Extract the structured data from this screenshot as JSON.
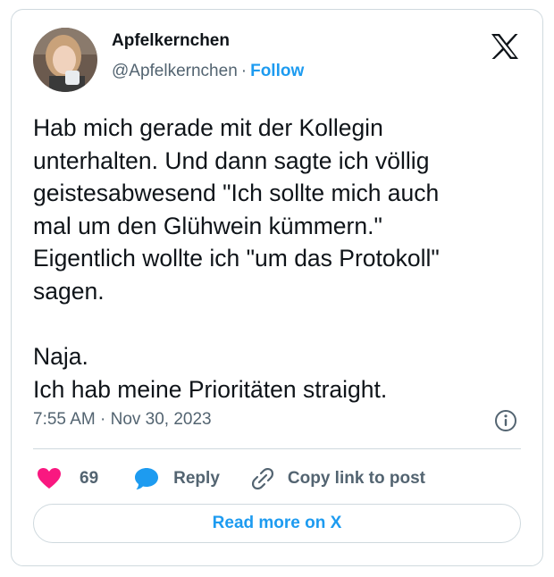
{
  "author": {
    "name": "Apfelkernchen",
    "handle": "@Apfelkernchen",
    "separator": "·",
    "follow_label": "Follow"
  },
  "tweet": {
    "text": "Hab mich gerade mit der Kollegin\nunterhalten. Und dann sagte ich völlig\ngeistesabwesend \"Ich sollte mich auch\nmal um den Glühwein kümmern.\"\nEigentlich wollte ich \"um das Protokoll\"\nsagen.\n\nNaja.\nIch hab meine Prioritäten straight.",
    "timestamp": "7:55 AM · Nov 30, 2023"
  },
  "actions": {
    "like_count": "69",
    "reply_label": "Reply",
    "copy_link_label": "Copy link to post"
  },
  "read_more_label": "Read more on X",
  "icons": {
    "platform": "x-logo-icon",
    "info": "info-icon",
    "like": "heart-icon",
    "reply": "speech-bubble-icon",
    "copy_link": "link-icon"
  },
  "colors": {
    "accent": "#1d9bf0",
    "like": "#f91880",
    "text": "#0f1419",
    "muted": "#536471",
    "border": "#cfd9de"
  }
}
